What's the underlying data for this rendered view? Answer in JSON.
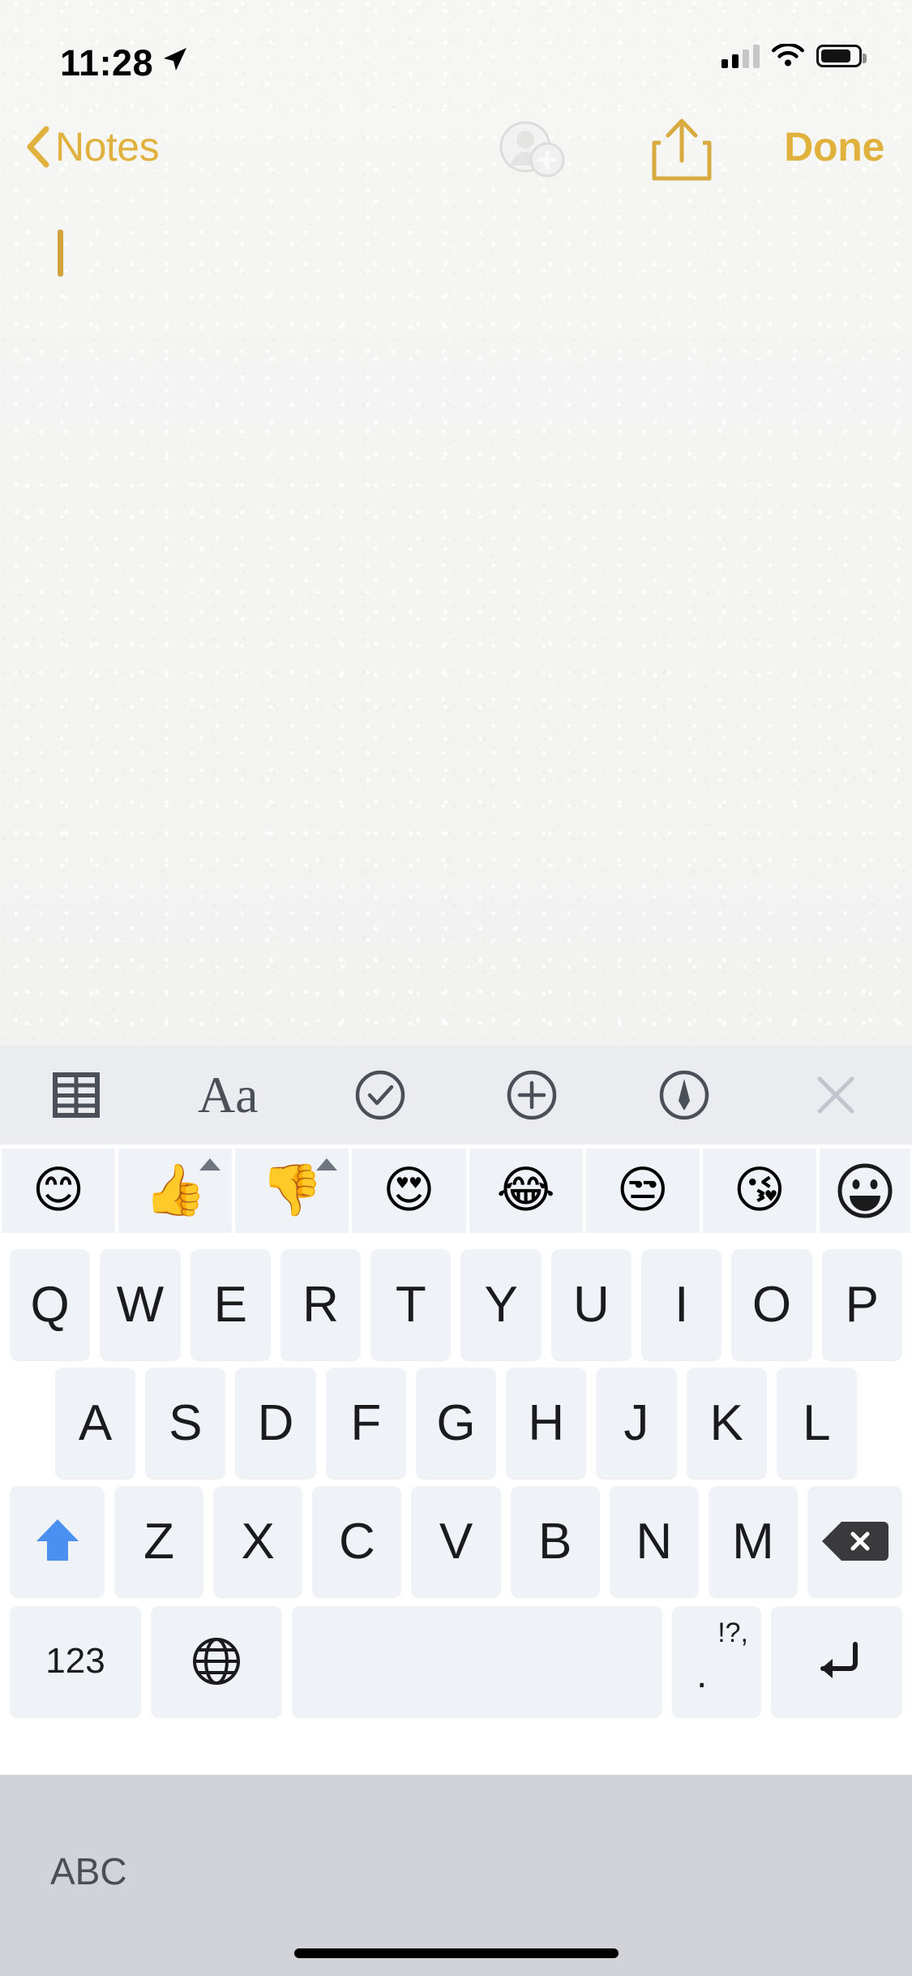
{
  "status_bar": {
    "time": "11:28",
    "location_icon": "location-arrow-icon",
    "cellular_icon": "cellular-bars-icon",
    "cellular_bars_filled": 2,
    "cellular_bars_total": 4,
    "wifi_icon": "wifi-icon",
    "battery_icon": "battery-icon",
    "battery_level_percent": 72
  },
  "nav_bar": {
    "back_label": "Notes",
    "back_icon": "chevron-left-icon",
    "add_person_icon": "add-person-icon",
    "share_icon": "share-icon",
    "done_label": "Done",
    "accent_color": "#e0b13c",
    "disabled_color": "#c9c9c9"
  },
  "note": {
    "text": "",
    "caret_color": "#cfa23a",
    "paper_color": "#f4f4f3"
  },
  "format_toolbar": {
    "background": "#eaecf0",
    "items": [
      {
        "name": "table-icon",
        "label": "Table"
      },
      {
        "name": "text-format-icon",
        "label": "Aa"
      },
      {
        "name": "checklist-icon",
        "label": "Checklist"
      },
      {
        "name": "add-attachment-icon",
        "label": "Add"
      },
      {
        "name": "markup-pen-icon",
        "label": "Markup"
      },
      {
        "name": "close-icon",
        "label": "Close"
      }
    ]
  },
  "emoji_predictions": {
    "background": "#eff2f7",
    "items": [
      {
        "emoji": "😊",
        "name": "smiling-face-emoji",
        "has_variant_marker": false
      },
      {
        "emoji": "👍",
        "name": "thumbs-up-emoji",
        "has_variant_marker": true
      },
      {
        "emoji": "👎",
        "name": "thumbs-down-emoji",
        "has_variant_marker": true
      },
      {
        "emoji": "😍",
        "name": "heart-eyes-emoji",
        "has_variant_marker": false
      },
      {
        "emoji": "😂",
        "name": "tears-of-joy-emoji",
        "has_variant_marker": false
      },
      {
        "emoji": "😒",
        "name": "unamused-face-emoji",
        "has_variant_marker": false
      },
      {
        "emoji": "😘",
        "name": "blowing-kiss-emoji",
        "has_variant_marker": false
      }
    ],
    "keyboard_toggle": {
      "name": "emoji-keyboard-icon",
      "glyph": "☺"
    }
  },
  "keyboard": {
    "row1": [
      "Q",
      "W",
      "E",
      "R",
      "T",
      "Y",
      "U",
      "I",
      "O",
      "P"
    ],
    "row2": [
      "A",
      "S",
      "D",
      "F",
      "G",
      "H",
      "J",
      "K",
      "L"
    ],
    "row3": [
      "Z",
      "X",
      "C",
      "V",
      "B",
      "N",
      "M"
    ],
    "shift_label": "shift-key",
    "delete_label": "delete-key",
    "numbers_label": "123",
    "globe_label": "globe-key",
    "space_label": "",
    "punct_small": "!?,",
    "punct_dot": ".",
    "return_label": "return-key",
    "shift_active_color": "#4a90f0",
    "key_background": "#eff2f7"
  },
  "bottom_bar": {
    "abc_label": "ABC",
    "background": "#d1d3d8"
  }
}
